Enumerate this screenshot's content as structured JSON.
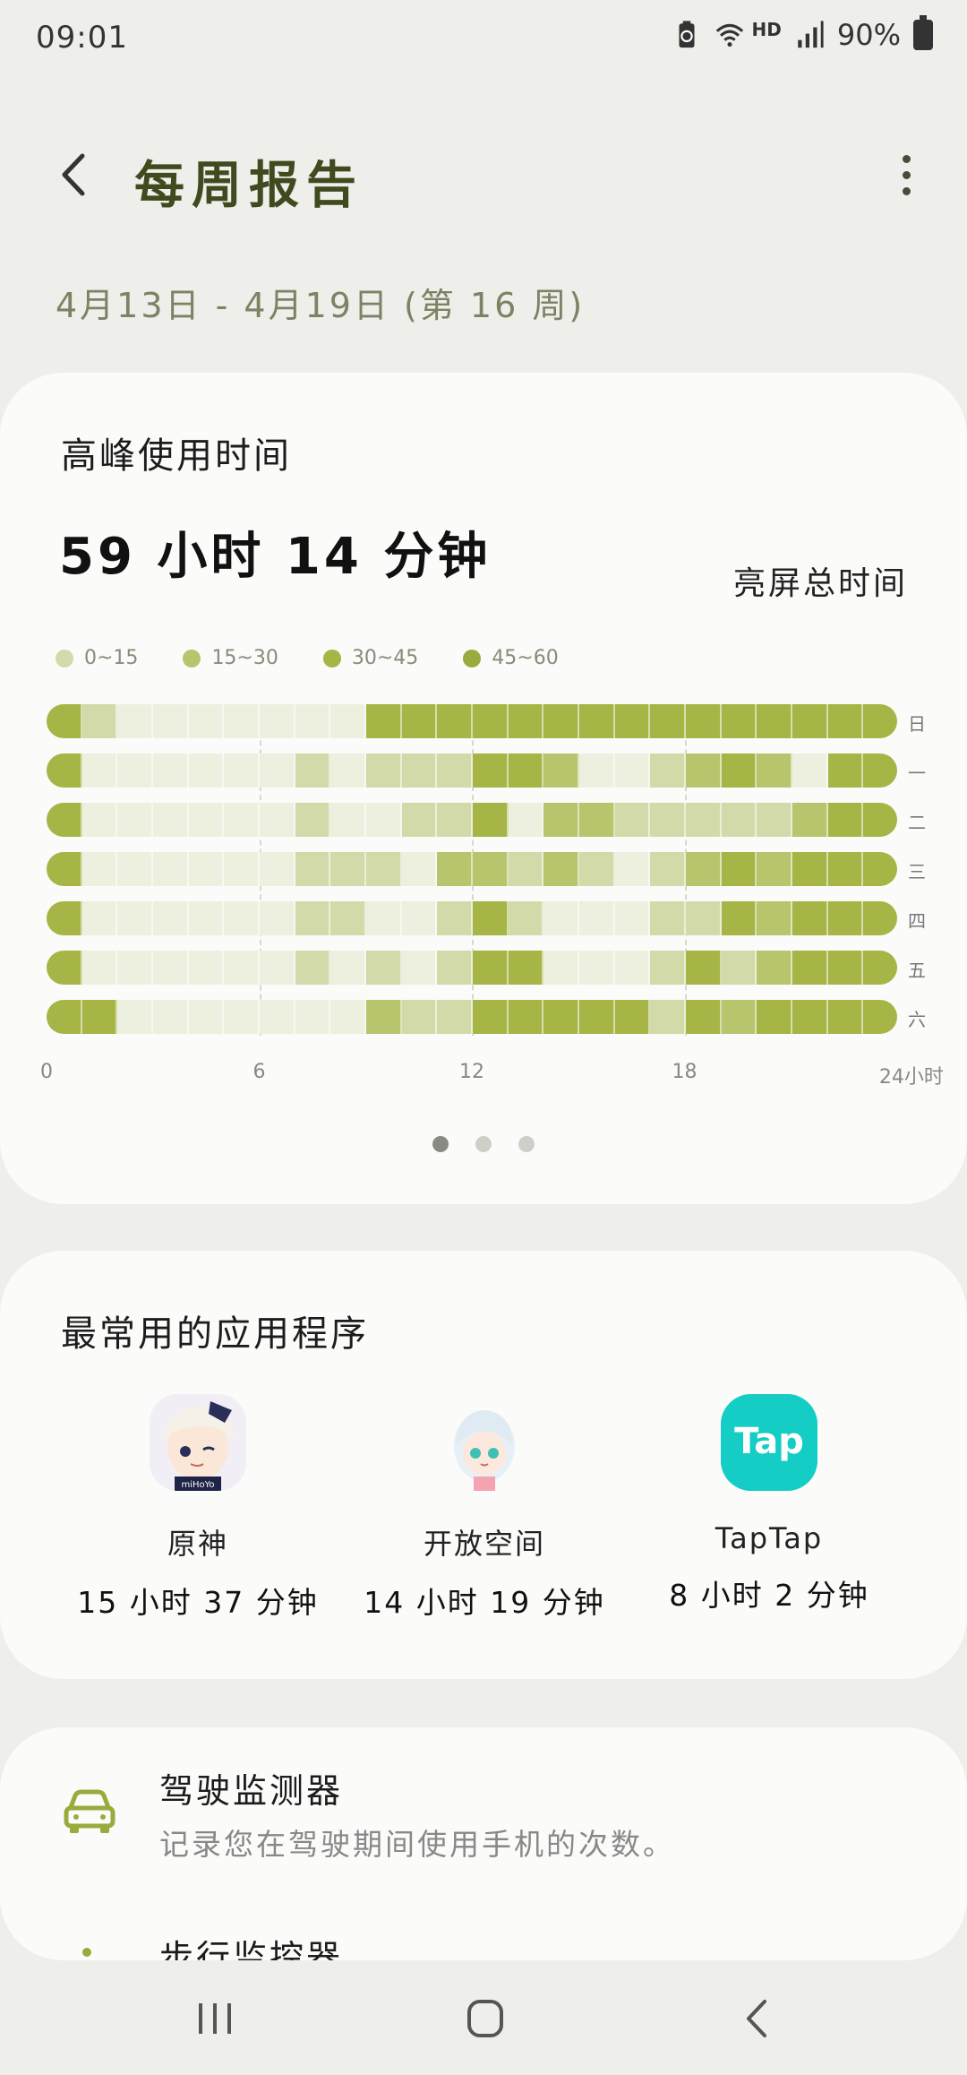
{
  "status_bar": {
    "time": "09:01",
    "network": "HD",
    "battery": "90%"
  },
  "header": {
    "title": "每周报告"
  },
  "date_range": "4月13日 - 4月19日 (第 16 周)",
  "peak_usage": {
    "title": "高峰使用时间",
    "total_time": "59 小时 14 分钟",
    "total_label": "亮屏总时间"
  },
  "colors": {
    "level1": "#eef0df",
    "level2": "#d3daa9",
    "level3": "#b9c56c",
    "level4": "#a6b545",
    "accent": "#9aab3e"
  },
  "chart_data": {
    "type": "heatmap",
    "legend": [
      "0~15",
      "15~30",
      "30~45",
      "45~60"
    ],
    "x_ticks": [
      "0",
      "6",
      "12",
      "18",
      "24小时"
    ],
    "xlim": [
      0,
      24
    ],
    "rows": [
      {
        "day": "日",
        "levels": [
          4,
          2,
          1,
          1,
          1,
          1,
          1,
          1,
          1,
          4,
          4,
          4,
          4,
          4,
          4,
          4,
          4,
          4,
          4,
          4,
          4,
          4,
          4,
          4
        ]
      },
      {
        "day": "一",
        "levels": [
          4,
          1,
          1,
          1,
          1,
          1,
          1,
          2,
          1,
          2,
          2,
          2,
          4,
          4,
          3,
          1,
          1,
          2,
          3,
          4,
          3,
          1,
          4,
          4
        ]
      },
      {
        "day": "二",
        "levels": [
          4,
          1,
          1,
          1,
          1,
          1,
          1,
          2,
          1,
          1,
          2,
          2,
          4,
          1,
          3,
          3,
          2,
          2,
          2,
          2,
          2,
          3,
          4,
          4
        ]
      },
      {
        "day": "三",
        "levels": [
          4,
          1,
          1,
          1,
          1,
          1,
          1,
          2,
          2,
          2,
          1,
          3,
          3,
          2,
          3,
          2,
          1,
          2,
          3,
          4,
          3,
          4,
          4,
          4
        ]
      },
      {
        "day": "四",
        "levels": [
          4,
          1,
          1,
          1,
          1,
          1,
          1,
          2,
          2,
          1,
          1,
          2,
          4,
          2,
          1,
          1,
          1,
          2,
          2,
          4,
          3,
          4,
          4,
          4
        ]
      },
      {
        "day": "五",
        "levels": [
          4,
          1,
          1,
          1,
          1,
          1,
          1,
          2,
          1,
          2,
          1,
          2,
          4,
          4,
          1,
          1,
          1,
          2,
          4,
          2,
          3,
          4,
          4,
          4
        ]
      },
      {
        "day": "六",
        "levels": [
          4,
          4,
          1,
          1,
          1,
          1,
          1,
          1,
          1,
          3,
          2,
          2,
          4,
          4,
          4,
          4,
          4,
          2,
          4,
          3,
          4,
          4,
          4,
          4
        ]
      }
    ]
  },
  "pager": {
    "pages": 3,
    "active": 0
  },
  "top_apps": {
    "title": "最常用的应用程序",
    "apps": [
      {
        "name": "原神",
        "time": "15 小时 37 分钟",
        "icon": "genshin-app-icon",
        "icon_text": "miHoYo"
      },
      {
        "name": "开放空间",
        "time": "14 小时 19 分钟",
        "icon": "open-space-app-icon"
      },
      {
        "name": "TapTap",
        "time": "8 小时 2 分钟",
        "icon": "taptap-app-icon",
        "icon_text": "Tap"
      }
    ]
  },
  "monitors": {
    "drive_title": "驾驶监测器",
    "drive_desc": "记录您在驾驶期间使用手机的次数。",
    "walk_title": "步行监控器"
  }
}
